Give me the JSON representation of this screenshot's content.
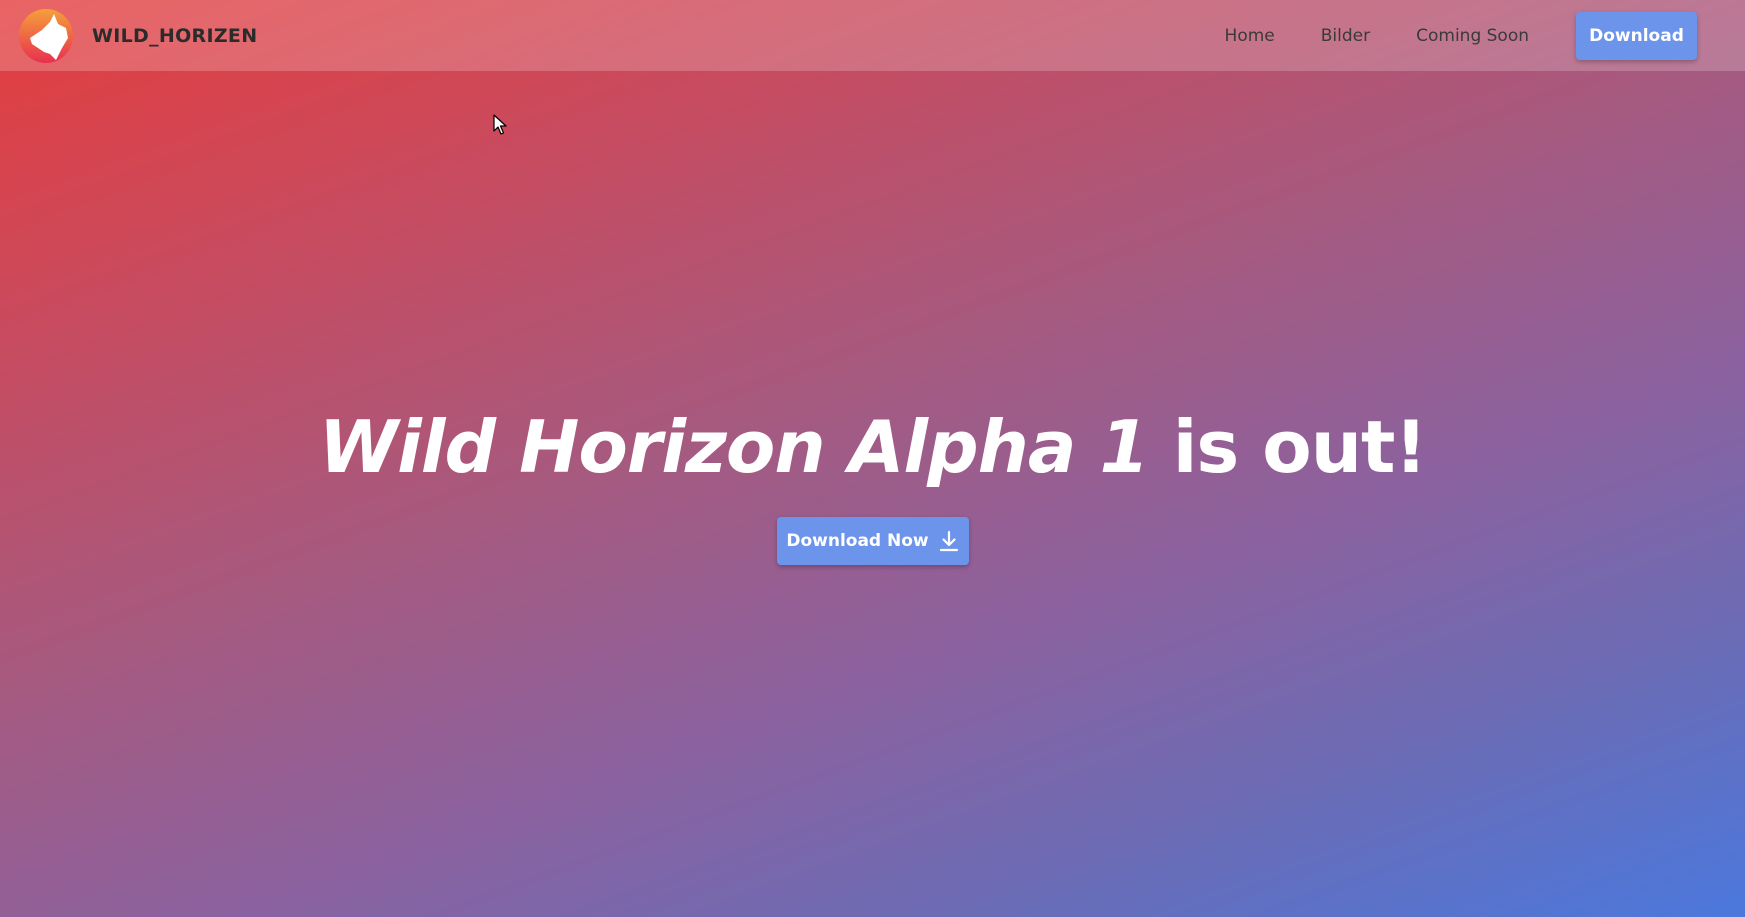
{
  "navbar": {
    "brand": "WILD_HORIZEN",
    "links": [
      "Home",
      "Bilder",
      "Coming Soon"
    ],
    "download_label": "Download"
  },
  "hero": {
    "title_highlight": "Wild Horizon Alpha 1",
    "title_rest": " is out!",
    "button_label": "Download Now",
    "button_icon": "download-icon"
  },
  "colors": {
    "accent_button": "#6d94eb",
    "gradient_start": "#e53d3d",
    "gradient_end": "#4b78dd",
    "brand_text": "#2b2b2b"
  }
}
